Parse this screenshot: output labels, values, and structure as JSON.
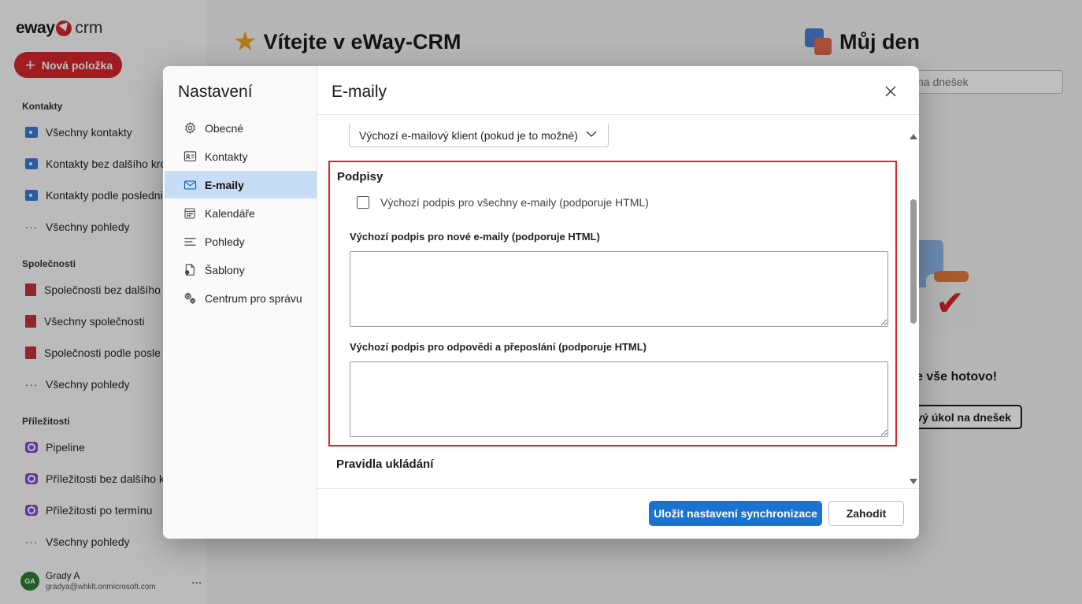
{
  "app": {
    "logo": {
      "brand": "eway",
      "suffix": "crm"
    },
    "new_item_label": "Nová položka",
    "sections": [
      {
        "title": "Kontakty",
        "items": [
          "Všechny kontakty",
          "Kontakty bez dalšího kro",
          "Kontakty podle posledni",
          "Všechny pohledy"
        ]
      },
      {
        "title": "Společnosti",
        "items": [
          "Společnosti bez dalšího",
          "Všechny společnosti",
          "Společnosti podle posle",
          "Všechny pohledy"
        ]
      },
      {
        "title": "Příležitosti",
        "items": [
          "Pipeline",
          "Příležitosti bez dalšího k",
          "Příležitosti po termínu",
          "Všechny pohledy"
        ]
      }
    ],
    "user": {
      "initials": "GA",
      "name": "Grady A",
      "email": "gradya@whklt.onmicrosoft.com",
      "more": "..."
    },
    "welcome_title": "Vítejte v eWay-CRM",
    "myday": {
      "title": "Můj den",
      "input_placeholder": "na dnešek",
      "done_text": "e vše hotovo!",
      "task_button": "vý úkol na dnešek"
    }
  },
  "dialog": {
    "nav_title": "Nastavení",
    "nav_items": [
      {
        "label": "Obecné",
        "icon": "gear-icon"
      },
      {
        "label": "Kontakty",
        "icon": "contact-card-icon"
      },
      {
        "label": "E-maily",
        "icon": "mail-icon",
        "active": true
      },
      {
        "label": "Kalendáře",
        "icon": "calendar-icon"
      },
      {
        "label": "Pohledy",
        "icon": "views-icon"
      },
      {
        "label": "Šablony",
        "icon": "template-icon"
      },
      {
        "label": "Centrum pro správu",
        "icon": "admin-gear-icon"
      }
    ],
    "title": "E-maily",
    "client_select": "Výchozí e-mailový klient (pokud je to možné)",
    "signatures": {
      "title": "Podpisy",
      "checkbox_label": "Výchozí podpis pro všechny e-maily (podporuje HTML)",
      "checkbox_checked": false,
      "new_label": "Výchozí podpis pro nové e-maily (podporuje HTML)",
      "new_value": "",
      "reply_label": "Výchozí podpis pro odpovědi a přeposlání (podporuje HTML)",
      "reply_value": ""
    },
    "next_section_title": "Pravidla ukládání",
    "save_button": "Uložit nastavení synchronizace",
    "cancel_button": "Zahodit"
  },
  "colors": {
    "brand_red": "#d6262b",
    "primary_blue": "#1a73d0",
    "active_nav": "#c7dcf5",
    "highlight_border": "#d6262b"
  }
}
